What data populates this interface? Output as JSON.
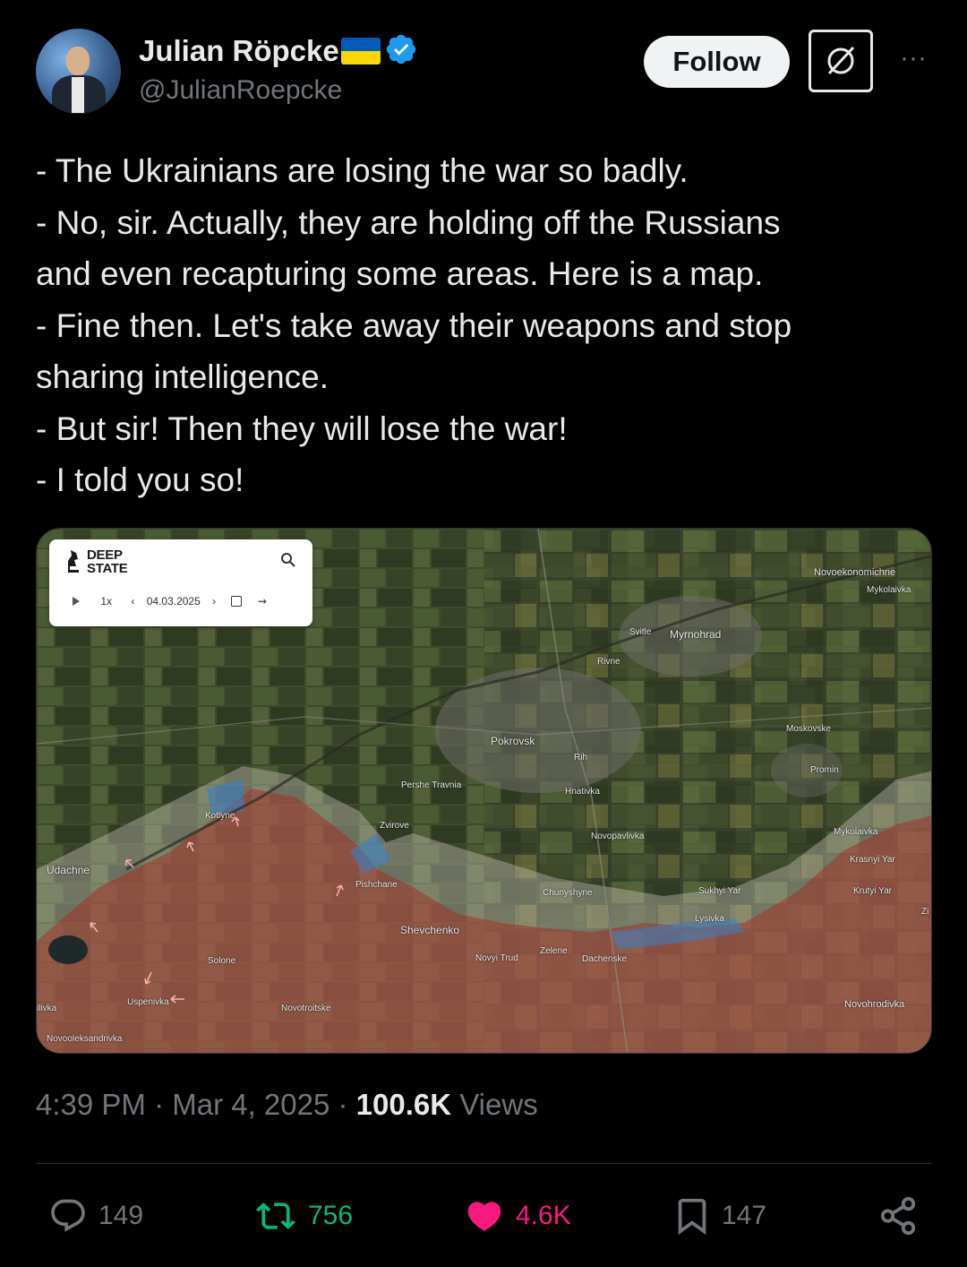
{
  "author": {
    "name": "Julian Röpcke",
    "handle": "@JulianRoepcke"
  },
  "header": {
    "follow_label": "Follow",
    "more_label": "···"
  },
  "tweet": {
    "lines": [
      "- The Ukrainians are losing the war so badly.",
      "- No, sir. Actually, they are holding off the Russians",
      "and even recapturing some areas. Here is a map.",
      "- Fine then. Let's take away their weapons and stop",
      "sharing intelligence.",
      "- But sir! Then they will lose the war!",
      "- I told you so!"
    ]
  },
  "map": {
    "logo_line1": "DEEP",
    "logo_line2": "STATE",
    "playback_speed": "1x",
    "date": "04.03.2025",
    "places": {
      "novoekonomichne": "Novoekonomichne",
      "mykolaivka_top": "Mykolaivka",
      "svitle": "Svitle",
      "myrnohrad": "Myrnohrad",
      "rivne": "Rivne",
      "pokrovsk": "Pokrovsk",
      "rih": "Rih",
      "moskovske": "Moskovske",
      "promin": "Promin",
      "pershe_travnia": "Pershe Travnia",
      "hnativka": "Hnativka",
      "kotlyne": "Kotlyne",
      "zvirove": "Zvirove",
      "novopavlivka": "Novopavlivka",
      "mykolaivka": "Mykolaivka",
      "krasnyi_yar": "Krasnyi Yar",
      "udachne": "Udachne",
      "pishchane": "Pishchane",
      "chunyshyne": "Chunyshyne",
      "sukhyi_yar": "Sukhyi Yar",
      "krutyi_yar": "Krutyi Yar",
      "lysivka": "Lysivka",
      "shevchenko": "Shevchenko",
      "novyi_trud": "Novyi Trud",
      "zelene": "Zelene",
      "dachenske": "Dachenske",
      "solone": "Solone",
      "uspenivka": "Uspenivka",
      "ilivka": "ilivka",
      "novotroitske": "Novotroitske",
      "novohrodivka": "Novohrodivka",
      "novooleksandrivka": "Novooleksandrivka",
      "zi": "Zi"
    }
  },
  "meta": {
    "time": "4:39 PM",
    "sep1": " · ",
    "date": "Mar 4, 2025",
    "sep2": " · ",
    "views_count": "100.6K",
    "views_label": " Views"
  },
  "actions": {
    "replies": "149",
    "reposts": "756",
    "likes": "4.6K",
    "bookmarks": "147"
  },
  "colors": {
    "background": "#000000",
    "text": "#e7e9ea",
    "muted": "#71767b",
    "verified": "#1d9bf0",
    "repost": "#00ba7c",
    "like": "#f91880",
    "divider": "#2f3336",
    "russian_area": "#a0352a",
    "ukrainian_recapture": "#3a7fc4",
    "grey_zone": "#c9c2b8"
  }
}
